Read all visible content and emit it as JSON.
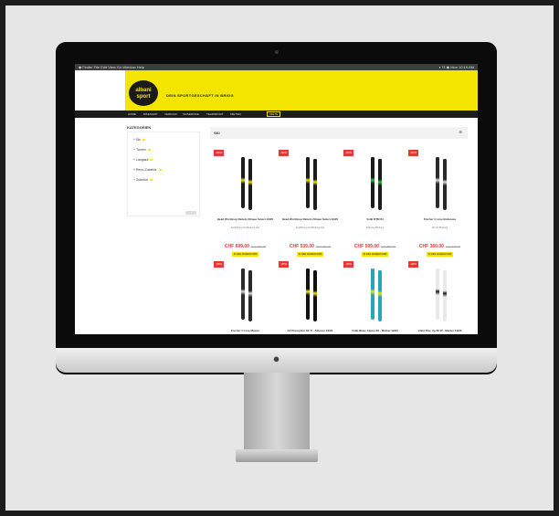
{
  "menubar": {
    "left": "◆ Finder  File  Edit  View  Go  Window  Help",
    "right": "◐  ☷  ◉  Mon 10:19 AM"
  },
  "brand": {
    "logo_line1": "albani",
    "logo_line2": "sport",
    "tagline": "DEIN SPORTGESCHÄFT IN BRIGG"
  },
  "nav": {
    "items": [
      "HOME",
      "BIKESHOP",
      "VERKAUF",
      "SKISERVICE",
      "MIETE",
      "TEAMSPORT",
      "MIETSKI"
    ],
    "active": "MIETE"
  },
  "sidebar": {
    "title": "KATEGORIEN",
    "categories": [
      {
        "label": "Ski"
      },
      {
        "label": "Touren"
      },
      {
        "label": "Langlauf"
      },
      {
        "label": "Renn-Zubehör"
      },
      {
        "label": "Zubehör"
      }
    ]
  },
  "main": {
    "title": "SKI",
    "view_icon": "☰"
  },
  "products": [
    {
      "badge": "-30%",
      "name": "Head Worldcup Rebels iShape Select 19/20",
      "desc": "Ausführung mit Bindung inkl.",
      "price": "CHF 699.00",
      "old_price": "CHF 999.00",
      "cart": "IN DEN WARENKORB",
      "ski_color": "#1c1c1c",
      "accent": "#e3e000"
    },
    {
      "badge": "-30%",
      "name": "Head Worldcup Rebels iShape Select 19/20",
      "desc": "Ausführung mit Bindung inkl.",
      "price": "CHF 539.00",
      "old_price": "CHF 769.00",
      "cart": "IN DEN WARENKORB",
      "ski_color": "#1c1c1c",
      "accent": "#e3e000"
    },
    {
      "badge": "-30%",
      "name": "Volkl RTM 84",
      "desc": "Inklusive Bindung",
      "price": "CHF 599.00",
      "old_price": "CHF 859.00",
      "cart": "IN DEN WARENKORB",
      "ski_color": "#1b1b1b",
      "accent": "#24c43a"
    },
    {
      "badge": "-30%",
      "name": "Fischer C-Line Endurace",
      "desc": "Ski mit Bindung",
      "price": "CHF 360.00",
      "old_price": "CHF 515.00",
      "cart": "IN DEN WARENKORB",
      "ski_color": "#2a2a2a",
      "accent": "#d8d8d8"
    },
    {
      "badge": "-30%",
      "name": "Fischer C-Line Master",
      "desc": "Ski mit Bindung",
      "price": "CHF 330.00",
      "old_price": "CHF 470.00",
      "cart": "IN DEN WARENKORB",
      "ski_color": "#2a2a2a",
      "accent": "#d8d8d8"
    },
    {
      "badge": "-30%",
      "name": "K2 Disruption 82 Ti - Alliance 19/20",
      "desc": "Skitourenski mit Bindung",
      "price": "CHF 1'469.00",
      "old_price": "CHF 2099.00",
      "cart": "IN DEN WARENKORB",
      "ski_color": "#111111",
      "accent": "#f3e500"
    },
    {
      "badge": "-30%",
      "name": "Völkl Blaze Alpine 86 - Marker 19/20",
      "desc": "Skitourenski mit Bindung",
      "price": "CHF 1'349.00",
      "old_price": "CHF 1929.00",
      "cart": "IN DEN WARENKORB",
      "ski_color": "#27a6b8",
      "accent": "#f3e500"
    },
    {
      "badge": "-30%",
      "name": "Völkl Rise Up 82 W - Marker 19/20",
      "desc": "Skitourenski mit Bindung",
      "price": "CHF 1'099.00",
      "old_price": "CHF 1569.00",
      "cart": "IN DEN WARENKORB",
      "ski_color": "#e9e9e9",
      "accent": "#1c1c1c"
    }
  ]
}
